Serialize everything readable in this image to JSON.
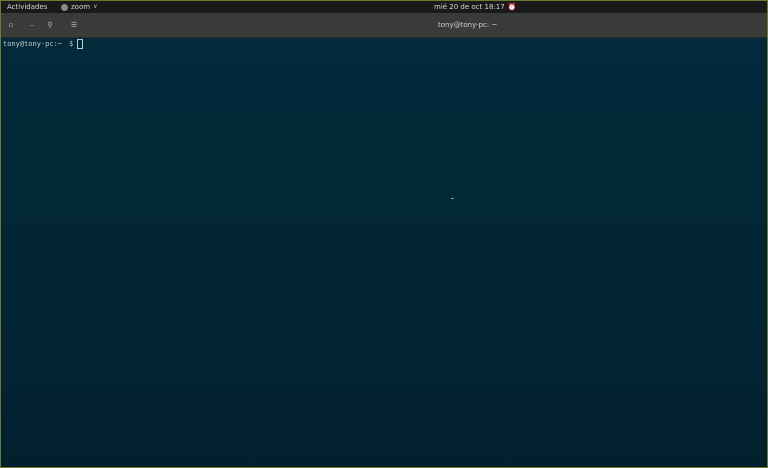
{
  "topbar": {
    "activities": "Actividades",
    "app_name": "zoom",
    "app_icon": "zoom-icon",
    "clock": "mié 20 de oct  18:17",
    "alarm_icon": "alarm-clock-icon"
  },
  "window": {
    "title": "tony@tony-pc: ~",
    "buttons": [
      {
        "icon": "terminal-icon",
        "glyph": "▫"
      },
      {
        "icon": "minimize-icon",
        "glyph": "–"
      },
      {
        "icon": "search-icon",
        "glyph": "⚲"
      },
      {
        "icon": "menu-icon",
        "glyph": "☰"
      }
    ]
  },
  "terminal": {
    "prompt": "tony@tony-pc",
    "separator": ":",
    "cwd": "~",
    "dollar": "$"
  },
  "colors": {
    "terminal_bg": "#022a3a",
    "topbar_bg": "#1a1a1a",
    "headerbar_bg": "#3a3a3a"
  }
}
